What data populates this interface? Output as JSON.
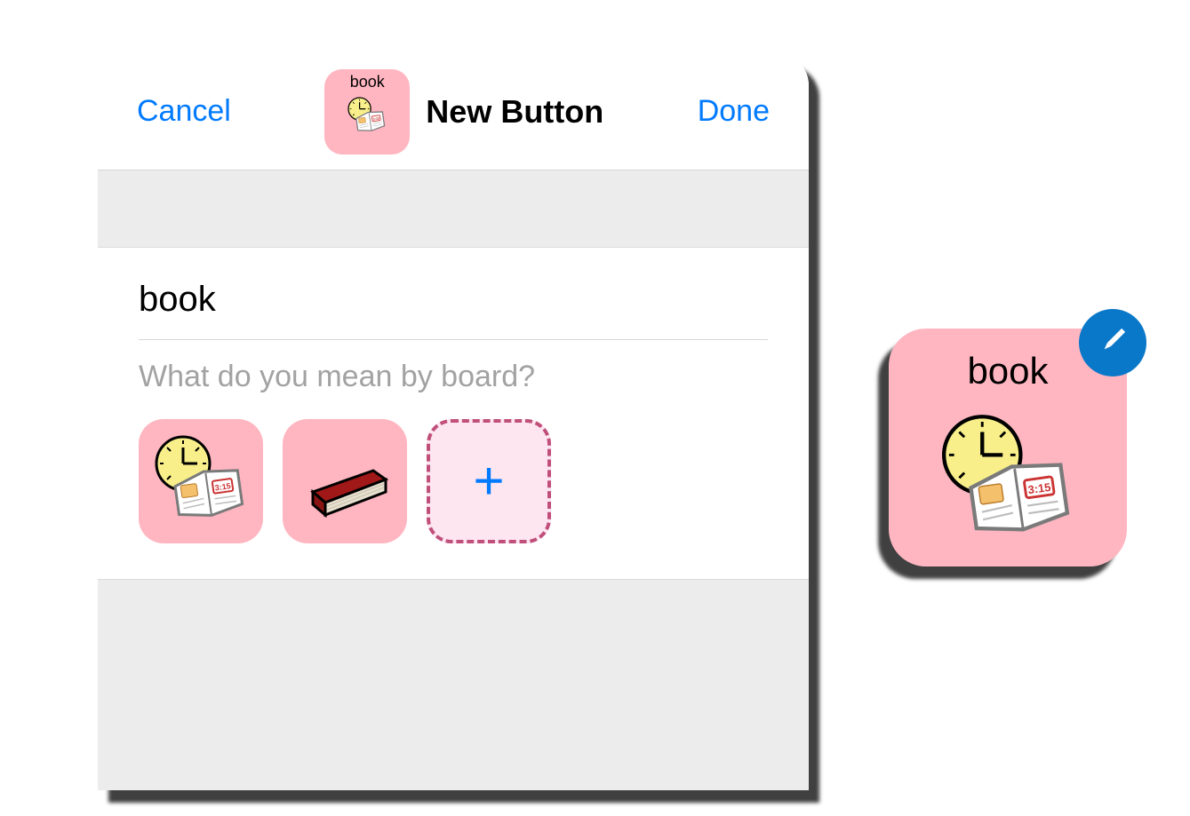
{
  "header": {
    "cancel_label": "Cancel",
    "done_label": "Done",
    "title": "New Button",
    "mini_tile_label": "book"
  },
  "form": {
    "label_value": "book",
    "prompt": "What do you mean by board?"
  },
  "tiles": {
    "option1_name": "clock-and-book",
    "option2_name": "red-book",
    "add_label": "+"
  },
  "preview": {
    "label": "book"
  },
  "colors": {
    "accent": "#007aff",
    "tile_pink": "#ffb6c1",
    "add_bg": "#fde6f0",
    "add_border": "#c04f7a",
    "badge_blue": "#0a78c9"
  }
}
